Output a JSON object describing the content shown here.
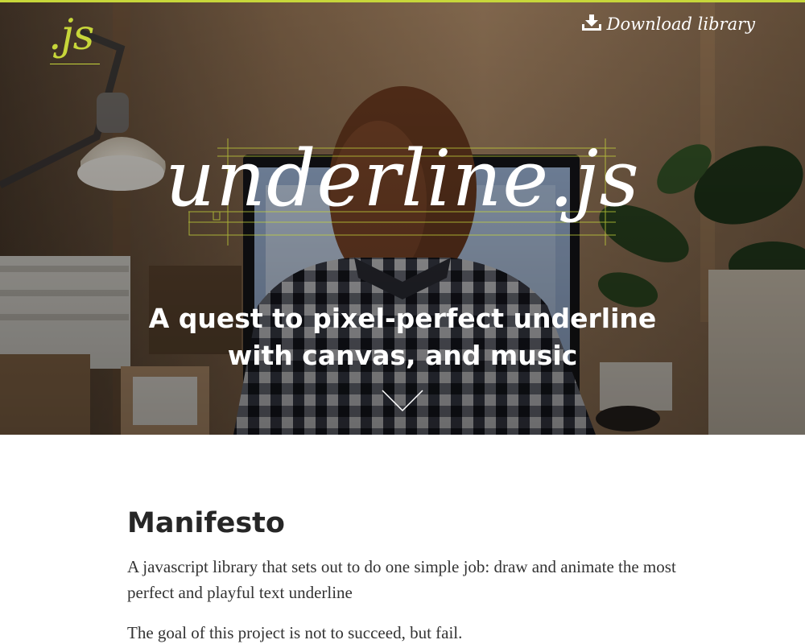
{
  "colors": {
    "accent": "#c7d63a",
    "hero_text": "#ffffff",
    "body_text": "#333333"
  },
  "header": {
    "logo": ".js",
    "download_label": "Download library",
    "download_icon": "download-icon"
  },
  "hero": {
    "title": "underline.js",
    "tagline_line1": "A quest to pixel-perfect underline",
    "tagline_line2": "with canvas, and music",
    "scroll_icon": "chevron-down-icon"
  },
  "manifesto": {
    "heading": "Manifesto",
    "paragraphs": [
      "A javascript library that sets out to do one simple job: draw and animate the most perfect and playful text underline",
      "The goal of this project is not to succeed, but fail."
    ]
  }
}
